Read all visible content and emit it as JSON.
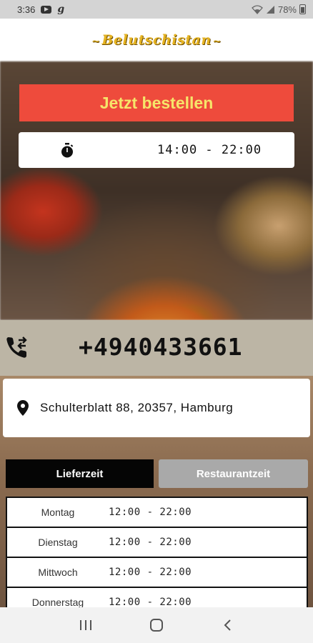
{
  "status_bar": {
    "time": "3:36",
    "battery": "78%",
    "icons": [
      "youtube-icon",
      "g-icon",
      "wifi-icon",
      "signal-icon",
      "battery-icon"
    ]
  },
  "header": {
    "logo_text": "Belutschistan"
  },
  "order_button": {
    "label": "Jetzt bestellen",
    "bg_color": "#ee4b3c",
    "text_color": "#f6e56a"
  },
  "opening_hours": {
    "icon": "stopwatch-icon",
    "time": "14:00 - 22:00"
  },
  "phone": {
    "icon": "phone-forward-icon",
    "number": "+4940433661"
  },
  "address": {
    "icon": "location-pin-icon",
    "text": "Schulterblatt 88, 20357, Hamburg"
  },
  "tabs": [
    {
      "label": "Lieferzeit",
      "active": true
    },
    {
      "label": "Restaurantzeit",
      "active": false
    }
  ],
  "schedule": [
    {
      "day": "Montag",
      "hours": "12:00 - 22:00"
    },
    {
      "day": "Dienstag",
      "hours": "12:00 - 22:00"
    },
    {
      "day": "Mittwoch",
      "hours": "12:00 - 22:00"
    },
    {
      "day": "Donnerstag",
      "hours": "12:00 - 22:00"
    }
  ],
  "nav_bar": {
    "icons": [
      "recent-apps-icon",
      "home-icon",
      "back-icon"
    ]
  }
}
